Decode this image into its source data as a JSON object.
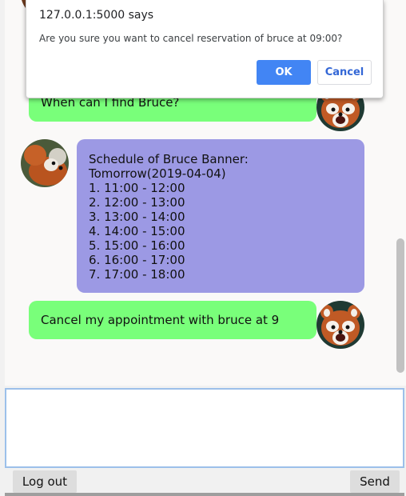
{
  "dialog": {
    "title": "127.0.0.1:5000 says",
    "message": "Are you sure you want to cancel reservation of bruce at 09:00?",
    "ok_label": "OK",
    "cancel_label": "Cancel"
  },
  "messages": [
    {
      "sender": "user",
      "text": "When can I find Bruce?"
    },
    {
      "sender": "bot",
      "header_lines": [
        "Schedule of Bruce Banner:",
        "Tomorrow(2019-04-04)"
      ],
      "schedule": [
        "1. 11:00 - 12:00",
        "2. 12:00 - 13:00",
        "3. 13:00 - 14:00",
        "4. 14:00 - 15:00",
        "5. 15:00 - 16:00",
        "6. 16:00 - 17:00",
        "7. 17:00 - 18:00"
      ]
    },
    {
      "sender": "user",
      "text": "Cancel my appointment with bruce at 9"
    }
  ],
  "input": {
    "value": "",
    "placeholder": ""
  },
  "buttons": {
    "logout_label": "Log out",
    "send_label": "Send"
  },
  "icons": {
    "user_avatar": "red-panda-avatar",
    "bot_avatar": "red-panda-avatar"
  },
  "colors": {
    "user_bubble": "#79ff7a",
    "bot_bubble": "#9c99e4",
    "ok_button": "#4285f4",
    "cancel_text": "#3367d6"
  }
}
